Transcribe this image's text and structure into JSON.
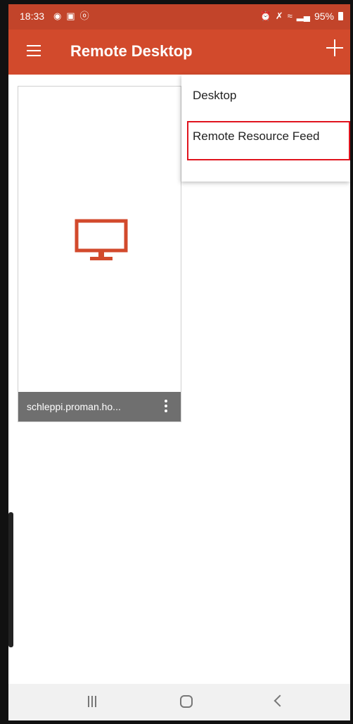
{
  "status_bar": {
    "time": "18:33",
    "battery": "95%",
    "icons": [
      "eye-icon",
      "cast-icon",
      "e-icon",
      "alarm-icon",
      "mute-icon",
      "wifi-icon",
      "signal-icon",
      "battery-icon"
    ]
  },
  "app_bar": {
    "title": "Remote Desktop",
    "menu_icon": "hamburger-icon",
    "add_icon": "plus-icon"
  },
  "tile": {
    "name": "schleppi.proman.ho...",
    "icon": "monitor-icon",
    "more_icon": "more-vert-icon"
  },
  "add_menu": {
    "items": [
      {
        "label": "Desktop"
      },
      {
        "label": "Remote Resource Feed"
      }
    ]
  },
  "nav_bar": {
    "icons": [
      "recents-icon",
      "home-icon",
      "back-icon"
    ]
  },
  "colors": {
    "accent": "#d24a2c",
    "status_bar": "#c2442a",
    "highlight": "#e0141e"
  }
}
